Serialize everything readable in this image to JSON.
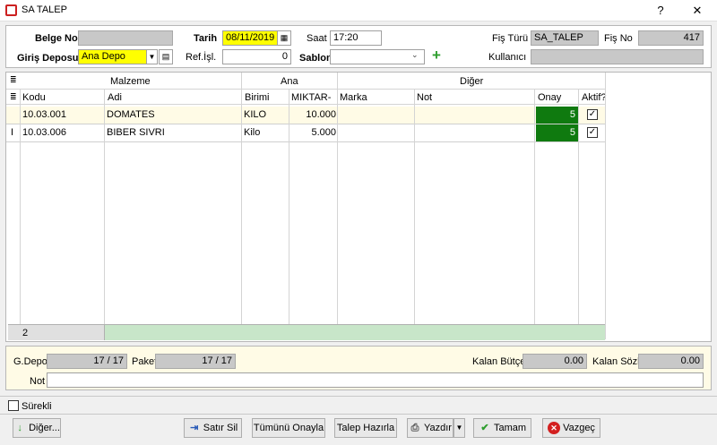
{
  "window": {
    "title": "SA TALEP",
    "help": "?",
    "close": "✕"
  },
  "header": {
    "belge_no_label": "Belge No",
    "belge_no_value": "",
    "giris_deposu_label": "Giriş Deposu",
    "giris_deposu_value": "Ana Depo",
    "tarih_label": "Tarih",
    "tarih_value": "08/11/2019",
    "ref_label": "Ref.İşl.",
    "ref_value": "0",
    "saat_label": "Saat",
    "saat_value": "17:20",
    "sablon_label": "Sablon",
    "sablon_value": "",
    "fis_turu_label": "Fiş Türü",
    "fis_turu_value": "SA_TALEP",
    "fis_no_label": "Fiş No",
    "fis_no_value": "417",
    "kullanici_label": "Kullanıcı",
    "kullanici_value": ""
  },
  "grid": {
    "groups": {
      "malzeme": "Malzeme",
      "ana": "Ana",
      "diger": "Diğer"
    },
    "columns": {
      "kodu": "Kodu",
      "adi": "Adi",
      "birimi": "Birimi",
      "miktar": "MIKTAR-",
      "marka": "Marka",
      "not": "Not",
      "onay": "Onay",
      "aktif": "Aktif?"
    },
    "rows": [
      {
        "indicator": "",
        "kodu": "10.03.001",
        "adi": "DOMATES",
        "birimi": "KILO",
        "miktar": "10.000",
        "marka": "",
        "not": "",
        "onay": "5",
        "aktif": "✓"
      },
      {
        "indicator": "I",
        "kodu": "10.03.006",
        "adi": "BIBER SIVRI",
        "birimi": "Kilo",
        "miktar": "5.000",
        "marka": "",
        "not": "",
        "onay": "5",
        "aktif": "✓"
      }
    ],
    "footer_count": "2"
  },
  "summary": {
    "gdepo_label": "G.Depo",
    "gdepo_value": "17 / 17",
    "paket_label": "Paket",
    "paket_value": "17 / 17",
    "kalan_butce_label": "Kalan Bütçe",
    "kalan_butce_value": "0.00",
    "kalan_sozl_label": "Kalan Sözl.",
    "kalan_sozl_value": "0.00",
    "not_label": "Not",
    "not_value": ""
  },
  "surekli_label": "Sürekli",
  "buttons": {
    "diger": "Diğer...",
    "satir_sil": "Satır Sil",
    "tumunu_onayla": "Tümünü Onayla",
    "talep_hazirla": "Talep Hazırla",
    "yazdir": "Yazdır",
    "tamam": "Tamam",
    "vazgec": "Vazgeç"
  },
  "colors": {
    "accent_green": "#0f7a0f",
    "row_highlight": "#fffbe6",
    "grid_footer": "#c8e6c9",
    "input_yellow": "#ffff00"
  }
}
